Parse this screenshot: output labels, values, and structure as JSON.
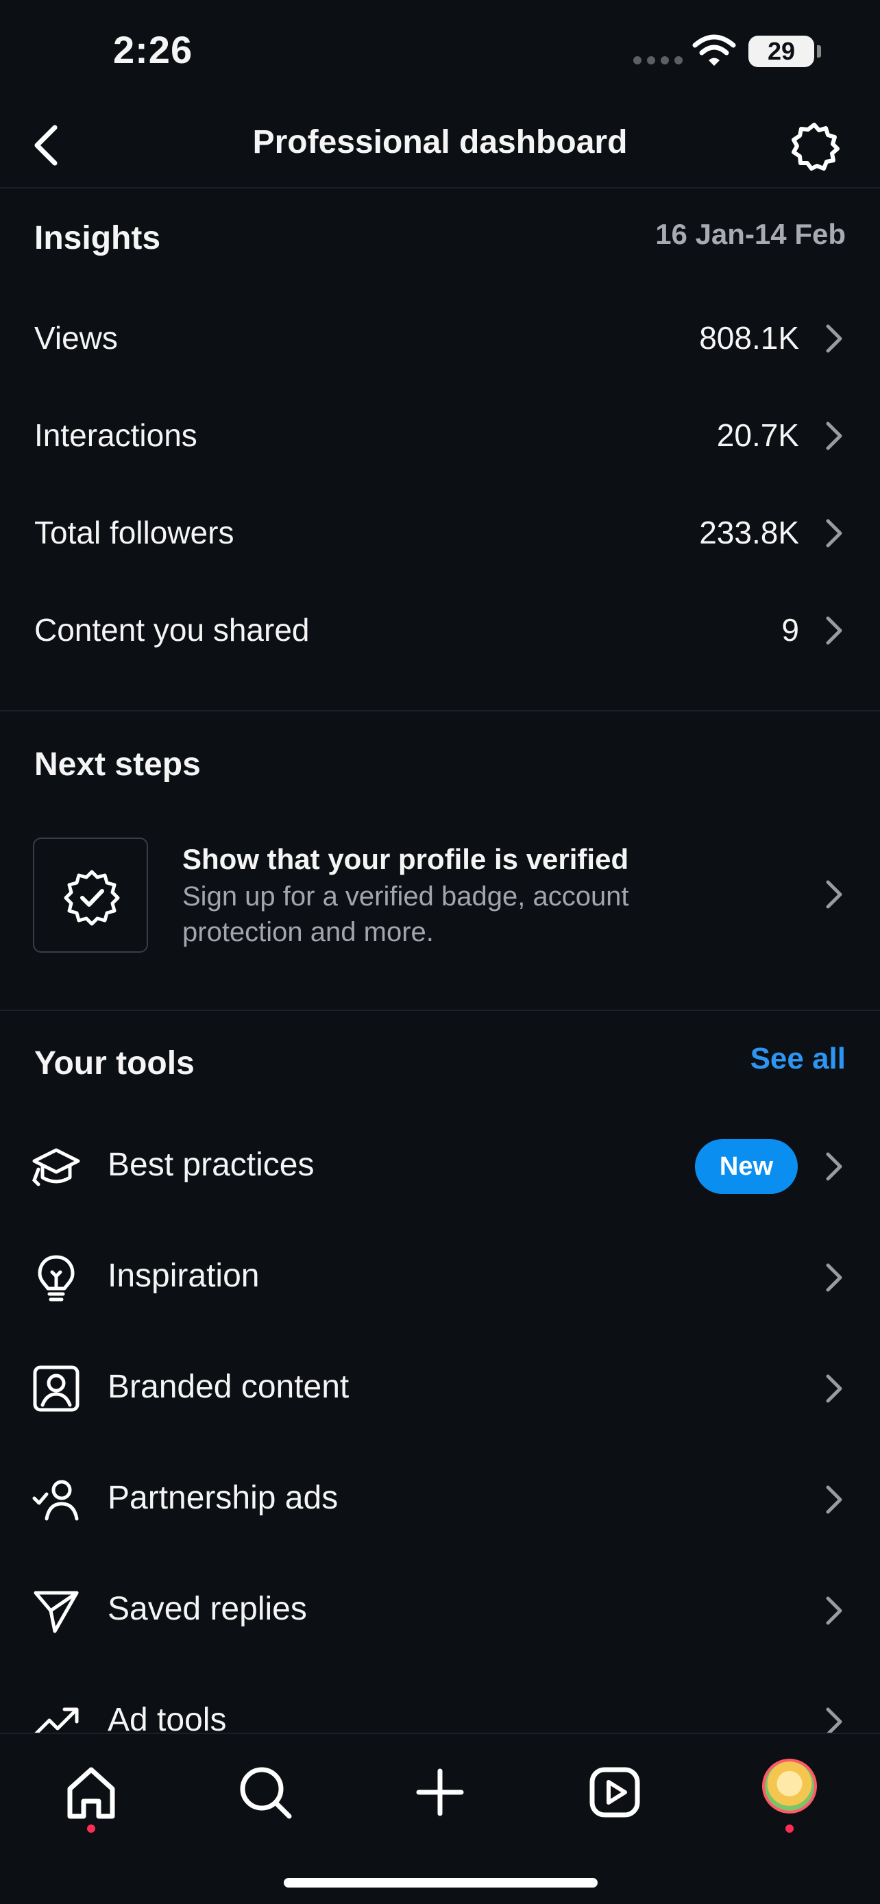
{
  "status_bar": {
    "time": "2:26",
    "battery": "29"
  },
  "nav": {
    "title": "Professional dashboard"
  },
  "insights": {
    "title": "Insights",
    "date_range": "16 Jan-14 Feb",
    "metrics": [
      {
        "label": "Views",
        "value": "808.1K"
      },
      {
        "label": "Interactions",
        "value": "20.7K"
      },
      {
        "label": "Total followers",
        "value": "233.8K"
      },
      {
        "label": "Content you shared",
        "value": "9"
      }
    ]
  },
  "next_steps": {
    "title": "Next steps",
    "card_title": "Show that your profile is verified",
    "card_desc": "Sign up for a verified badge, account protection and more."
  },
  "tools": {
    "title": "Your tools",
    "see_all": "See all",
    "items": [
      {
        "label": "Best practices",
        "icon": "graduation-cap-icon",
        "badge": "New"
      },
      {
        "label": "Inspiration",
        "icon": "lightbulb-icon"
      },
      {
        "label": "Branded content",
        "icon": "person-card-icon"
      },
      {
        "label": "Partnership ads",
        "icon": "person-check-icon"
      },
      {
        "label": "Saved replies",
        "icon": "send-icon"
      },
      {
        "label": "Ad tools",
        "icon": "trending-up-icon"
      }
    ]
  },
  "tabbar": {
    "items": [
      "home-icon",
      "search-icon",
      "create-icon",
      "reels-icon",
      "profile-avatar"
    ]
  },
  "colors": {
    "background": "#0c0f14",
    "accent": "#2d95f2",
    "badge": "#0a8ff0",
    "notification_dot": "#ff2d55"
  }
}
